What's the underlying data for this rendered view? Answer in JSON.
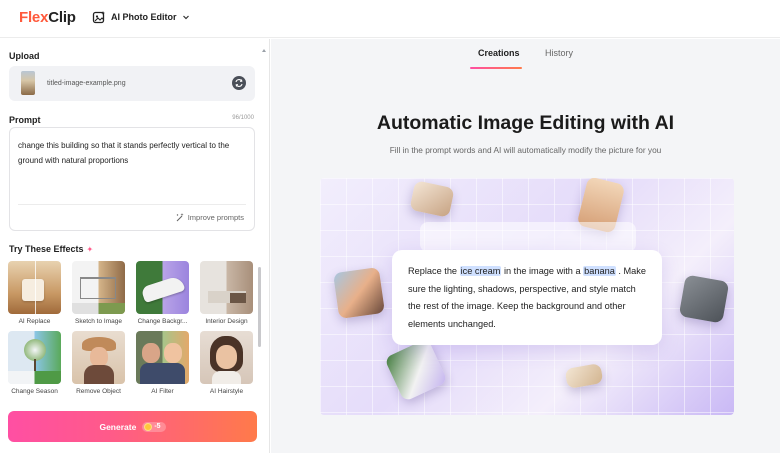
{
  "app": {
    "logo_part1": "Flex",
    "logo_part2": "Clip",
    "editor_name": "AI Photo Editor"
  },
  "upload": {
    "label": "Upload",
    "filename": "titled-image-example.png"
  },
  "prompt": {
    "label": "Prompt",
    "counter": "96/1000",
    "text": "change this building so that it stands perfectly vertical to the ground with natural proportions",
    "improve_label": "Improve prompts"
  },
  "effects": {
    "label": "Try These Effects",
    "items": [
      {
        "label": "AI Replace"
      },
      {
        "label": "Sketch to Image"
      },
      {
        "label": "Change Backgr..."
      },
      {
        "label": "Interior Design"
      },
      {
        "label": "Change Season"
      },
      {
        "label": "Remove Object"
      },
      {
        "label": "AI Filter"
      },
      {
        "label": "AI Hairstyle"
      }
    ]
  },
  "generate": {
    "label": "Generate",
    "cost": "-5"
  },
  "tabs": [
    {
      "label": "Creations",
      "active": true
    },
    {
      "label": "History",
      "active": false
    }
  ],
  "hero": {
    "title": "Automatic Image Editing with AI",
    "subtitle": "Fill in the prompt words and AI will automatically modify the picture for you"
  },
  "demo": {
    "t1": "Replace the ",
    "h1": "ice cream",
    "t2": " in the image with a ",
    "h2": "banana",
    "t3": " . Make sure the lighting, shadows, perspective, and style match the rest of the image. Keep the background and other elements unchanged."
  },
  "colors": {
    "accent_start": "#ff4fa3",
    "accent_end": "#ff7a4a",
    "highlight": "#cfe0ff"
  }
}
